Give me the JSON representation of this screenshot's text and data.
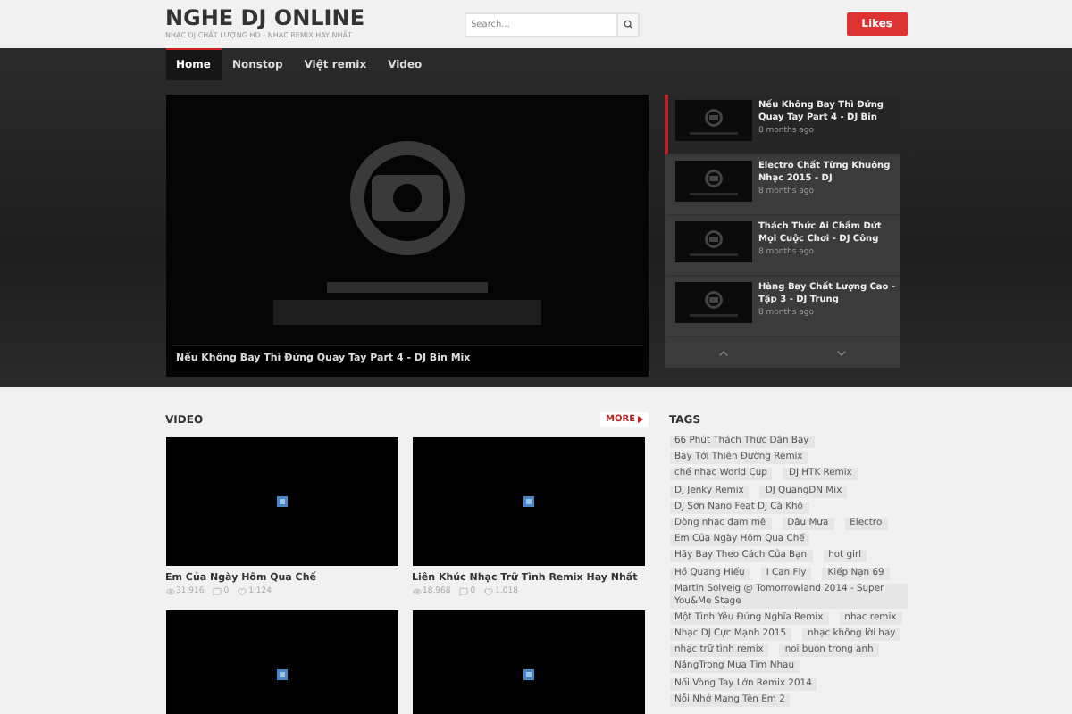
{
  "site": {
    "title": "NGHE DJ ONLINE",
    "tagline": "NHẠC DJ CHẤT LƯỢNG HD - NHẠC REMIX HAY NHẤT"
  },
  "search": {
    "placeholder": "Search..."
  },
  "likes_button": "Likes",
  "nav": [
    {
      "label": "Home",
      "selected": true
    },
    {
      "label": "Nonstop",
      "selected": false
    },
    {
      "label": "Việt remix",
      "selected": false
    },
    {
      "label": "Video",
      "selected": false
    }
  ],
  "featured": {
    "caption": "Nếu Không Bay Thì Đứng Quay Tay Part 4 - DJ Bin Mix"
  },
  "slider_items": [
    {
      "title": "Nếu Không Bay Thì Đứng Quay Tay Part 4 - DJ Bin",
      "time": "8 months ago",
      "selected": true
    },
    {
      "title": "Electro Chất Từng Khuông Nhạc 2015 - DJ",
      "time": "8 months ago",
      "selected": false
    },
    {
      "title": "Thách Thức Ai Chấm Dứt Mọi Cuộc Chơi - DJ Công",
      "time": "8 months ago",
      "selected": false
    },
    {
      "title": "Hàng Bay Chất Lượng Cao - Tập 3 - DJ Trung",
      "time": "8 months ago",
      "selected": false
    }
  ],
  "video_section": {
    "title": "VIDEO",
    "more": "MORE",
    "videos": [
      {
        "kind": "full",
        "title": "Em Của Ngày Hôm Qua Chế",
        "views": "31.916",
        "comments": "0",
        "likes": "1.124"
      },
      {
        "kind": "full",
        "title": "Liên Khúc Nhạc Trữ Tình Remix Hay Nhất",
        "views": "18.968",
        "comments": "0",
        "likes": "1.018"
      },
      {
        "kind": "thumbnail_only"
      },
      {
        "kind": "thumbnail_only"
      }
    ]
  },
  "tags": {
    "title": "TAGS",
    "items": [
      "66 Phút Thách Thức Dân Bay",
      "Bay Tới Thiên Đường Remix",
      "chế nhạc World Cup",
      "DJ HTK Remix",
      "DJ Jenky Remix",
      "DJ QuangDN Mix",
      "DJ Sơn Nano Feat DJ Cà Khô",
      "Dòng nhạc đam mê",
      "Dâu Mưa",
      "Electro",
      "Em Của Ngày Hôm Qua Chế",
      "Hãy Bay Theo Cách Của Bạn",
      "hot girl",
      "Hồ Quang Hiếu",
      "I Can Fly",
      "Kiếp Nạn 69",
      "Martin Solveig @ Tomorrowland 2014 - Super You&Me Stage",
      "Một Tình Yêu Đúng Nghĩa Remix",
      "nhac remix",
      "Nhạc DJ Cực Mạnh 2015",
      "nhạc không lời hay",
      "nhạc trữ tình remix",
      "noi buon trong anh",
      "NắngTrong Mưa Tìm Nhau",
      "Nối Vòng Tay Lớn Remix 2014",
      "Nỗi Nhớ Mang Tên Em 2"
    ]
  }
}
